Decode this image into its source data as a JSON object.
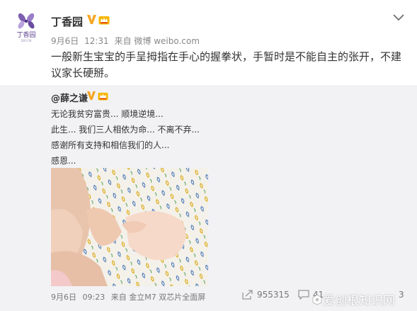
{
  "account": {
    "name": "丁香园",
    "avatar_text": "丁香园",
    "avatar_subtext": "DXY.CN"
  },
  "post": {
    "date": "9月6日",
    "time": "12:31",
    "source_prefix": "来自",
    "source": "微博 weibo.com",
    "text": "一般新生宝宝的手呈拇指在手心的握拳状，手暂时是不能自主的张开，不建议家长硬掰。"
  },
  "repost": {
    "author": "@薛之谦",
    "lines": [
      "无论我贫穷富贵... 顺境逆境...",
      "此生... 我们三人相依为命... 不离不弃...",
      "感谢所有支持和相信我们的人...",
      "感恩..."
    ],
    "date": "9月6日",
    "time": "09:23",
    "source_prefix": "来自",
    "source": "金立M7 双芯片全面屏",
    "repost_count": "955315",
    "comment_count": "41",
    "like_count_partial": "3"
  },
  "watermark": {
    "text": "爱创根知识网"
  },
  "icons": {
    "verified": "verified-v-icon",
    "member": "member-crown-icon",
    "more": "chevron-down-icon",
    "repost": "repost-icon",
    "comment": "comment-icon"
  },
  "colors": {
    "verified": "#f5a623",
    "brand_purple": "#5b3c8f",
    "meta_gray": "#888888",
    "repost_bg": "#f2f2f5"
  }
}
